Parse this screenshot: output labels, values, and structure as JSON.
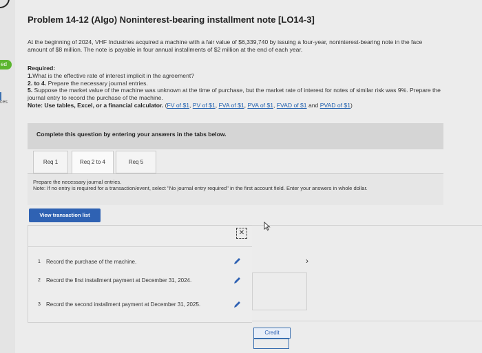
{
  "sidebar": {
    "tab_label": "ed",
    "text": "ces"
  },
  "problem": {
    "title": "Problem 14-12 (Algo) Noninterest-bearing installment note [LO14-3]",
    "intro": "At the beginning of 2024, VHF Industries acquired a machine with a fair value of $6,339,740 by issuing a four-year, noninterest-bearing note in the face amount of $8 million. The note is payable in four annual installments of $2 million at the end of each year."
  },
  "required": {
    "heading": "Required:",
    "r1_num": "1.",
    "r1_text": "What is the effective rate of interest implicit in the agreement?",
    "r2_num": "2. to 4.",
    "r2_text": " Prepare the necessary journal entries.",
    "r5_num": "5.",
    "r5_text": " Suppose the market value of the machine was unknown at the time of purchase, but the market rate of interest for notes of similar risk was 9%. Prepare the journal entry to record the purchase of the machine.",
    "note_label": "Note: Use tables, Excel, or a financial calculator.",
    "links": [
      "FV of $1",
      "PV of $1",
      "FVA of $1",
      "PVA of $1",
      "FVAD of $1",
      "PVAD of $1"
    ],
    "and_text": "and"
  },
  "instruction": "Complete this question by entering your answers in the tabs below.",
  "tabs": [
    {
      "label": "Req 1"
    },
    {
      "label": "Req 2 to 4"
    },
    {
      "label": "Req 5"
    }
  ],
  "prepare": {
    "line1": "Prepare the necessary journal entries.",
    "line2": "Note: If no entry is required for a transaction/event, select \"No journal entry required\" in the first account field. Enter your answers in whole dollar."
  },
  "view_button": "View transaction list",
  "transactions": [
    {
      "num": "1",
      "text": "Record the purchase of the machine."
    },
    {
      "num": "2",
      "text": "Record the first installment payment at December 31, 2024."
    },
    {
      "num": "3",
      "text": "Record the second installment payment at December 31, 2025."
    }
  ],
  "close_glyph": "✕",
  "chevron_glyph": "›",
  "credit_label": "Credit",
  "colors": {
    "accent": "#2f62b3",
    "sidebar_green": "#5bb52e"
  }
}
